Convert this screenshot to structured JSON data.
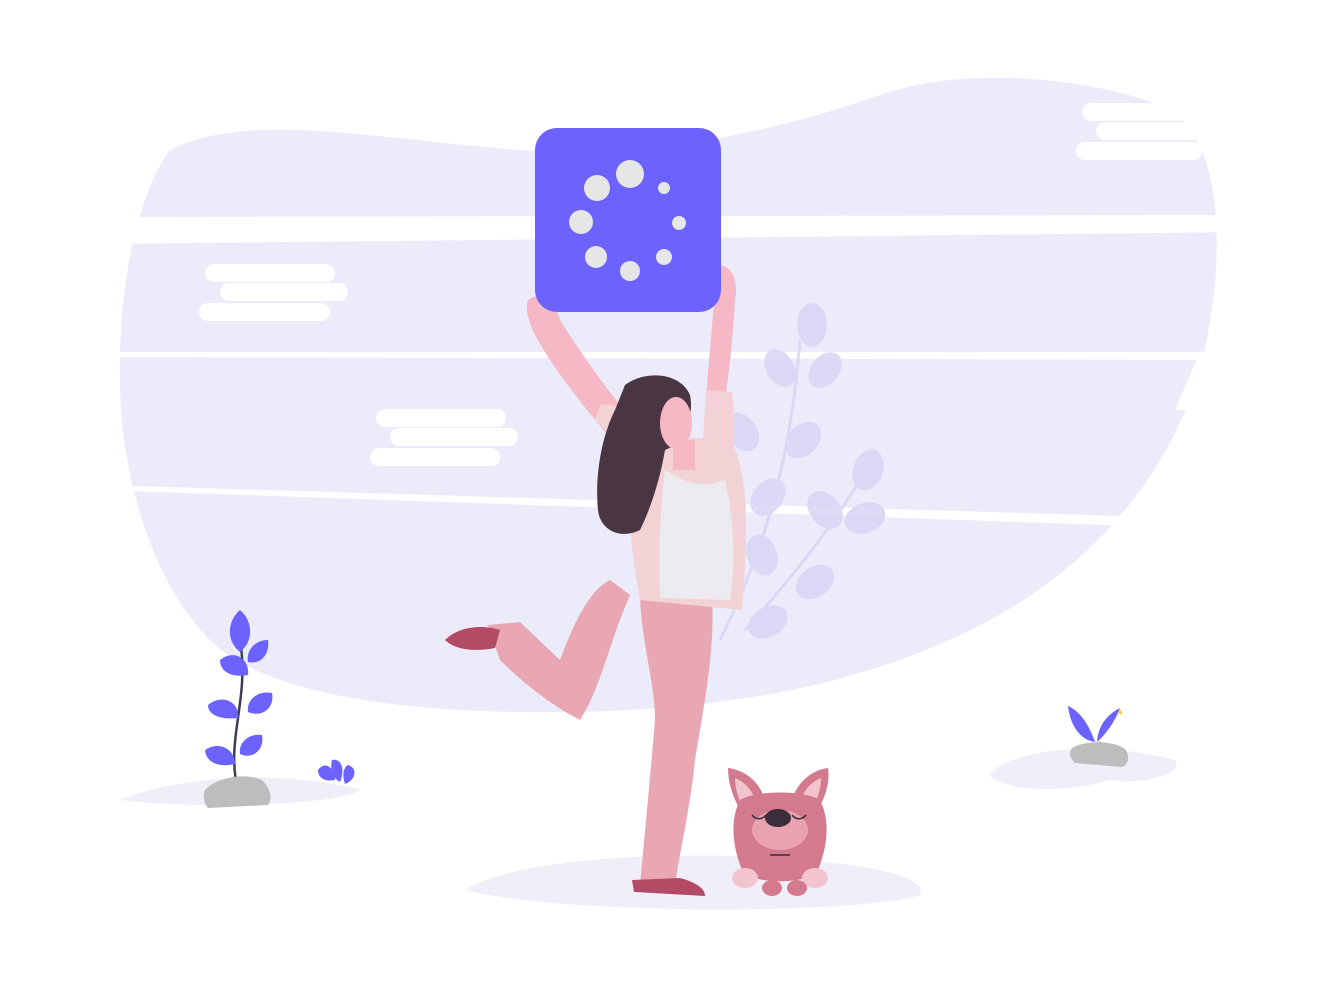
{
  "illustration": {
    "subject": "loading-illustration",
    "colors": {
      "background": "#ffffff",
      "blob": "#ecebfa",
      "stripe": "#ffffff",
      "accent": "#6c63ff",
      "accent_light": "#d9d7f5",
      "spinner_dots": "#e6e6e6",
      "skin": "#f5b8c4",
      "skin_shadow": "#e9a3b0",
      "hair": "#4a3542",
      "jacket": "#f3d2d6",
      "tank_top": "#ecebf0",
      "pants": "#e8a7b3",
      "shoes": "#b44b66",
      "dog_body": "#d47a8f",
      "dog_light": "#f2c4cd",
      "dog_nose": "#3b2d3a",
      "rock": "#bdbdbd",
      "ground": "#f0eff9",
      "plant_stem": "#3f3d56"
    },
    "icons": [
      "loading-spinner-icon",
      "plant-icon",
      "small-flower-icon",
      "sprout-icon",
      "rock-icon",
      "cloud-icon"
    ]
  }
}
